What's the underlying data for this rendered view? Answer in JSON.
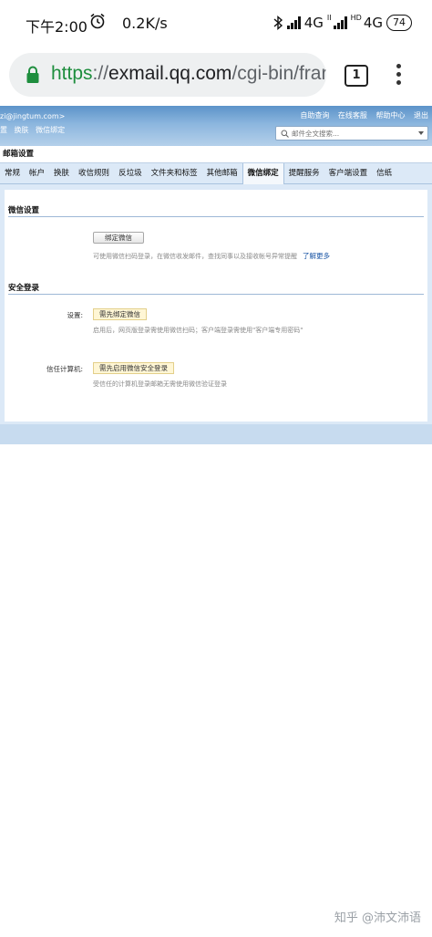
{
  "status_bar": {
    "time": "下午2:00",
    "speed": "0.2K/s",
    "network1": "4G",
    "network1_sub": "II",
    "hd": "HD",
    "network2": "4G",
    "battery": "74"
  },
  "browser": {
    "url_scheme": "https",
    "url_sep": "://",
    "url_host": "exmail.qq.com",
    "url_path": "/cgi-bin/frar",
    "tab_count": "1"
  },
  "mail_header": {
    "user_email": "zi@jingtum.com>",
    "left_links": [
      "置",
      "换肤",
      "微信绑定"
    ],
    "right_links": [
      "自助查询",
      "在线客服",
      "帮助中心",
      "退出"
    ],
    "search_placeholder": "邮件全文搜索..."
  },
  "settings_title": "邮箱设置",
  "tabs": [
    {
      "label": "常规",
      "active": false
    },
    {
      "label": "帐户",
      "active": false
    },
    {
      "label": "换肤",
      "active": false
    },
    {
      "label": "收信规则",
      "active": false
    },
    {
      "label": "反垃圾",
      "active": false
    },
    {
      "label": "文件夹和标签",
      "active": false
    },
    {
      "label": "其他邮箱",
      "active": false
    },
    {
      "label": "微信绑定",
      "active": true
    },
    {
      "label": "提醒服务",
      "active": false
    },
    {
      "label": "客户端设置",
      "active": false
    },
    {
      "label": "信纸",
      "active": false
    }
  ],
  "wechat_section": {
    "title": "微信设置",
    "bind_button": "绑定微信",
    "hint": "可使用微信扫码登录，在微信收发邮件，查找同事以及接收帐号异常提醒",
    "learn_more": "了解更多"
  },
  "security_section": {
    "title": "安全登录",
    "setting_label": "设置:",
    "setting_button": "需先绑定微信",
    "setting_hint": "启用后，网页版登录需使用微信扫码；客户端登录需使用\"客户端专用密码\"",
    "trusted_label": "信任计算机:",
    "trusted_button": "需先启用微信安全登录",
    "trusted_hint": "受信任的计算机登录邮箱无需使用微信验证登录"
  },
  "watermark": "知乎 @沛文沛语"
}
